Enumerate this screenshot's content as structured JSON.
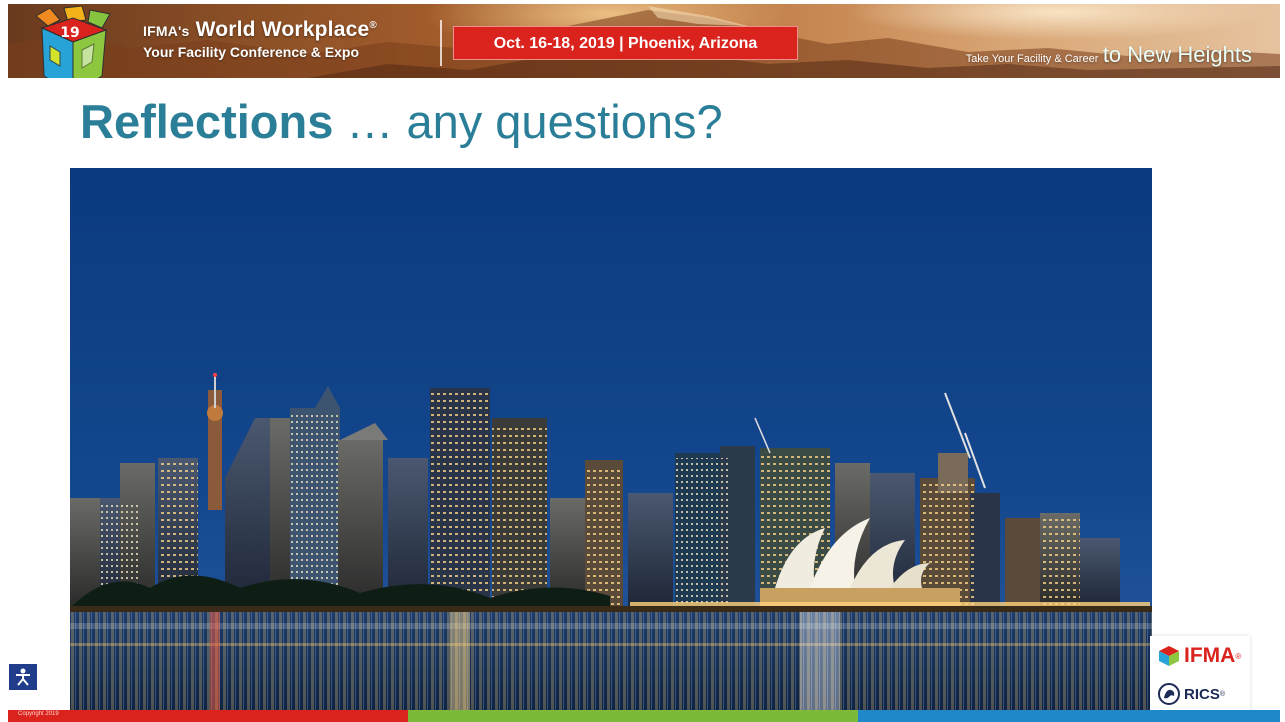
{
  "banner": {
    "brand_prefix": "IFMA's",
    "brand_name": "World Workplace",
    "brand_reg": "®",
    "brand_subtitle": "Your Facility Conference & Expo",
    "event_dates": "Oct. 16-18, 2019 | Phoenix, Arizona",
    "tagline_small": "Take Your Facility & Career",
    "tagline_big": "to New Heights",
    "cube_number": "19"
  },
  "slide": {
    "title_bold": "Reflections",
    "title_rest": " … any questions?"
  },
  "logos": {
    "ifma": "IFMA",
    "ifma_reg": "®",
    "rics": "RICS",
    "rics_reg": "®"
  },
  "footer": {
    "copyright": "Copyright 2019"
  },
  "colors": {
    "title": "#2a7e97",
    "event_red": "#d9231c",
    "footer_green": "#7cb83a",
    "footer_blue": "#1e88c8",
    "sky": "#0f3f85"
  }
}
